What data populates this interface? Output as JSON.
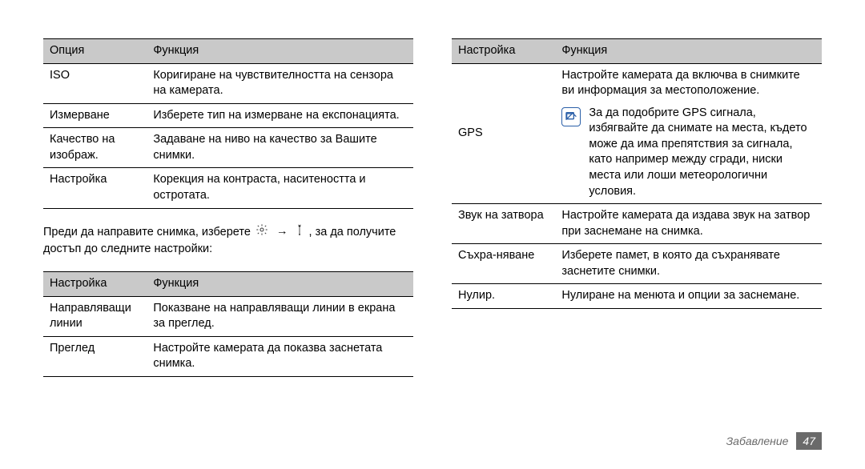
{
  "table1": {
    "head": {
      "c1": "Опция",
      "c2": "Функция"
    },
    "rows": [
      {
        "c1": "ISO",
        "c2": "Коригиране на чувствителността на сензора на камерата."
      },
      {
        "c1": "Измерване",
        "c2": "Изберете тип на измерване на експонацията."
      },
      {
        "c1": "Качество на изображ.",
        "c2": "Задаване на ниво на качество за Вашите снимки."
      },
      {
        "c1": "Настройка",
        "c2": "Корекция на контраста, наситеността и остротата."
      }
    ]
  },
  "paragraph_pre": "Преди да направите снимка, изберете ",
  "paragraph_mid": ", за да получите достъп до следните настройки:",
  "arrow": "→",
  "table2": {
    "head": {
      "c1": "Настройка",
      "c2": "Функция"
    },
    "rows": [
      {
        "c1": "Направляващи линии",
        "c2": "Показване на направляващи линии в екрана за преглед."
      },
      {
        "c1": "Преглед",
        "c2": "Настройте камерата да показва заснетата снимка."
      }
    ]
  },
  "table3": {
    "head": {
      "c1": "Настройка",
      "c2": "Функция"
    },
    "gps": {
      "c1": "GPS",
      "c2a": "Настройте камерата да включва в снимките ви информация за местоположение.",
      "c2b": "За да подобрите GPS сигнала, избягвайте да снимате на места, където може да има препятствия за сигнала, като например между сгради, ниски места или лоши метеорологични условия."
    },
    "rows": [
      {
        "c1": "Звук на затвора",
        "c2": "Настройте камерата да издава звук на затвор при заснемане на снимка."
      },
      {
        "c1": "Съхра-няване",
        "c2": "Изберете памет, в която да съхранявате заснетите снимки."
      },
      {
        "c1": "Нулир.",
        "c2": "Нулиране на менюта и опции за заснемане."
      }
    ]
  },
  "footer": {
    "label": "Забавление",
    "page": "47"
  }
}
